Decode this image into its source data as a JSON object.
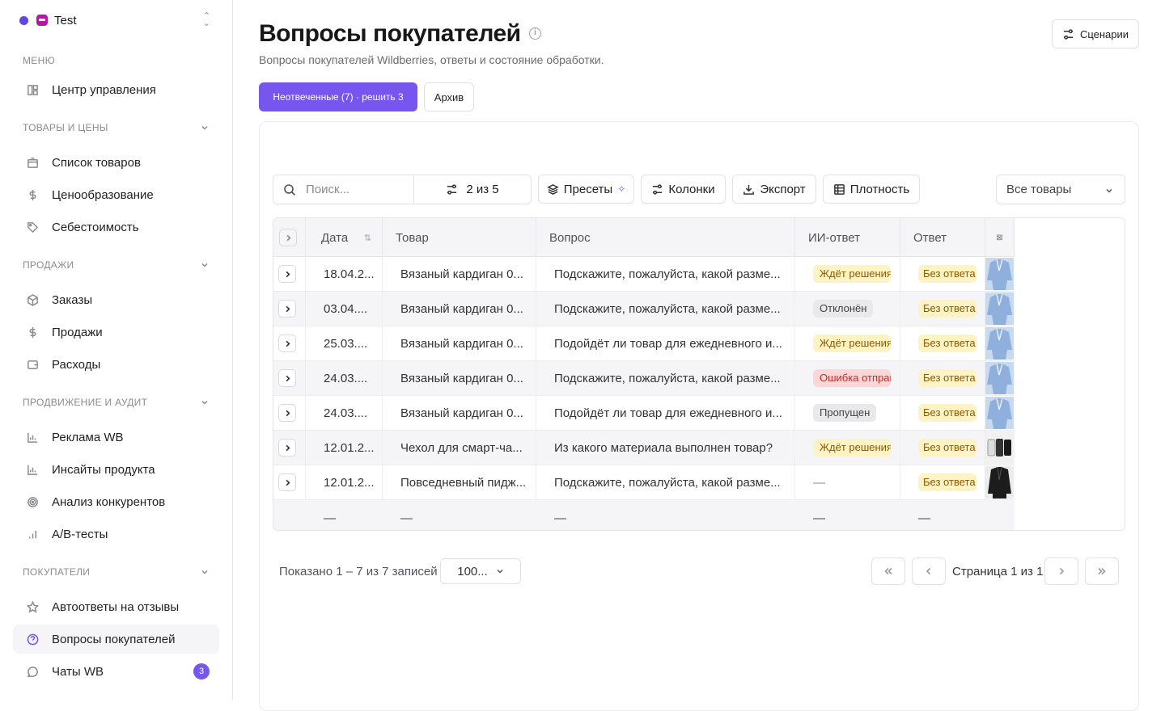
{
  "workspace": {
    "name": "Test"
  },
  "sidebar": {
    "sections": [
      {
        "title": "МЕНЮ"
      },
      {
        "title": "ТОВАРЫ И ЦЕНЫ"
      },
      {
        "title": "ПРОДАЖИ"
      },
      {
        "title": "ПРОДВИЖЕНИЕ И АУДИТ"
      },
      {
        "title": "ПОКУПАТЕЛИ"
      }
    ],
    "items": [
      {
        "label": "Центр управления",
        "icon": "dashboard-icon"
      },
      {
        "label": "Список товаров",
        "icon": "box-icon"
      },
      {
        "label": "Ценообразование",
        "icon": "dollar-icon"
      },
      {
        "label": "Себестоимость",
        "icon": "tag-icon"
      },
      {
        "label": "Заказы",
        "icon": "package-icon"
      },
      {
        "label": "Продажи",
        "icon": "dollar-icon"
      },
      {
        "label": "Расходы",
        "icon": "wallet-icon"
      },
      {
        "label": "Реклама WB",
        "icon": "bar-chart-icon"
      },
      {
        "label": "Инсайты продукта",
        "icon": "bar-chart-icon"
      },
      {
        "label": "Анализ конкурентов",
        "icon": "target-icon"
      },
      {
        "label": "A/B-тесты",
        "icon": "signal-icon"
      },
      {
        "label": "Автоответы на отзывы",
        "icon": "star-icon"
      },
      {
        "label": "Вопросы покупателей",
        "icon": "help-circle-icon",
        "active": true
      },
      {
        "label": "Чаты WB",
        "icon": "chat-icon",
        "badge": "3"
      }
    ]
  },
  "header": {
    "title": "Вопросы покупателей",
    "subtitle": "Вопросы покупателей Wildberries, ответы и состояние обработки.",
    "scenarios_label": "Сценарии"
  },
  "tabs": {
    "active": "Неотвеченные (7) · решить 3",
    "archive": "Архив"
  },
  "toolbar": {
    "search_placeholder": "Поиск...",
    "filter_count": "2 из 5",
    "presets": "Пресеты",
    "columns": "Колонки",
    "export": "Экспорт",
    "density": "Плотность",
    "product_filter": "Все товары"
  },
  "table": {
    "columns": [
      "Дата",
      "Товар",
      "Вопрос",
      "ИИ-ответ",
      "Ответ"
    ],
    "rows": [
      {
        "date": "18.04.2...",
        "product": "Вязаный кардиган 0...",
        "question": "Подскажите, пожалуйста, какой разме...",
        "ai": "Ждёт решения",
        "ai_kind": "wait",
        "answer": "Без ответа",
        "thumb": "cardigan"
      },
      {
        "date": "03.04....",
        "product": "Вязаный кардиган 0...",
        "question": "Подскажите, пожалуйста, какой разме...",
        "ai": "Отклонён",
        "ai_kind": "rej",
        "answer": "Без ответа",
        "thumb": "cardigan"
      },
      {
        "date": "25.03....",
        "product": "Вязаный кардиган 0...",
        "question": "Подойдёт ли товар для ежедневного и...",
        "ai": "Ждёт решения",
        "ai_kind": "wait",
        "answer": "Без ответа",
        "thumb": "cardigan"
      },
      {
        "date": "24.03....",
        "product": "Вязаный кардиган 0...",
        "question": "Подскажите, пожалуйста, какой разме...",
        "ai": "Ошибка отправки",
        "ai_kind": "err",
        "answer": "Без ответа",
        "thumb": "cardigan"
      },
      {
        "date": "24.03....",
        "product": "Вязаный кардиган 0...",
        "question": "Подойдёт ли товар для ежедневного и...",
        "ai": "Пропущен",
        "ai_kind": "skip",
        "answer": "Без ответа",
        "thumb": "cardigan"
      },
      {
        "date": "12.01.2...",
        "product": "Чехол для смарт-ча...",
        "question": "Из какого материала выполнен товар?",
        "ai": "Ждёт решения",
        "ai_kind": "wait",
        "answer": "Без ответа",
        "thumb": "case"
      },
      {
        "date": "12.01.2...",
        "product": "Повседневный пидж...",
        "question": "Подскажите, пожалуйста, какой разме...",
        "ai": "—",
        "ai_kind": "none",
        "answer": "Без ответа",
        "thumb": "jacket"
      }
    ],
    "footer_dash": "—"
  },
  "pagination": {
    "summary": "Показано 1 – 7 из 7 записей",
    "page_size": "100...",
    "page_label": "Страница 1 из 1"
  },
  "colors": {
    "accent": "#7656ee"
  }
}
